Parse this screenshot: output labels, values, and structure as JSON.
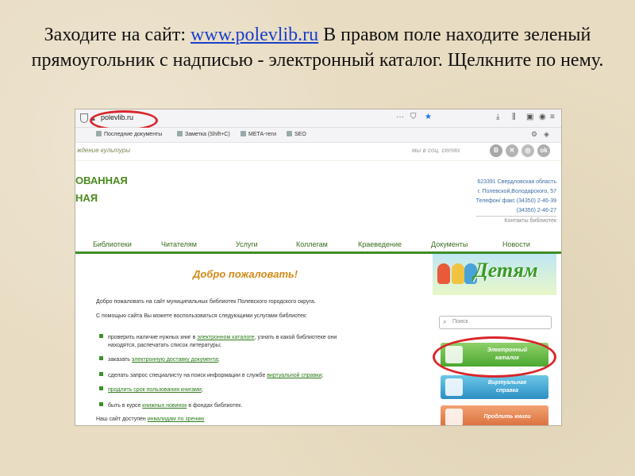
{
  "slide": {
    "title_before": "Заходите на сайт: ",
    "title_link": "www.polevlib.ru",
    "title_after": " В правом поле находите зеленый прямоугольник с надписью - электронный каталог. Щелкните по нему."
  },
  "browser": {
    "url": "polevlib.ru",
    "bookmarks": [
      "Последние документы",
      "Заметка (Shift+C)",
      "МЕТА-теги",
      "SEO"
    ]
  },
  "site": {
    "subtitle": "ждение культуры",
    "social_label": "мы в соц. сетях",
    "social_icons": [
      "В",
      "✕",
      "◎",
      "ok"
    ],
    "name_line1": "ОВАННАЯ",
    "name_line2": "НАЯ",
    "contacts": {
      "line1": "623391 Свердловская область",
      "line2": "г. Полевской,Володарского, 57",
      "line3": "Телефон/ факс (34350) 2-46-39",
      "line4": "(34350) 2-46-27",
      "link": "Контакты библиотек"
    },
    "nav": [
      "Библиотеки",
      "Читателям",
      "Услуги",
      "Коллегам",
      "Краеведение",
      "Документы",
      "Новости"
    ]
  },
  "main": {
    "welcome": "Добро пожаловать!",
    "intro": "Добро пожаловать на сайт муниципальных библиотек Полевского городского округа.",
    "services_intro": "С помощью сайта Вы можете воспользоваться следующими услугами библиотек:",
    "items": [
      {
        "pre": "проверить наличие нужных книг в ",
        "link": "электронном каталоге",
        "post": ", узнать в какой библиотеке они"
      },
      {
        "pre": "находятся, распечатать список литературы;",
        "link": "",
        "post": ""
      },
      {
        "pre": "заказать ",
        "link": "электронную доставку документа",
        "post": ";"
      },
      {
        "pre": "сделать запрос специалисту на поиск информации в службе ",
        "link": "виртуальной справки",
        "post": ";"
      },
      {
        "pre": "",
        "link": "продлить срок пользования книгами",
        "post": ";"
      },
      {
        "pre": "быть в курсе ",
        "link": "книжных новинок",
        "post": " в фондах библиотек."
      }
    ],
    "footer_pre": "Наш сайт доступен ",
    "footer_link": "инвалидам по зрению"
  },
  "sidebar": {
    "kids": "Детям",
    "search_placeholder": "Поиск",
    "catalog_line1": "Электронный",
    "catalog_line2": "каталог",
    "virtual_line1": "Виртуальная",
    "virtual_line2": "справка",
    "renew": "Продлить книги"
  },
  "colors": {
    "highlight": "#d8262a",
    "site_green": "#3f8d28",
    "link_blue": "#1a3fc9"
  }
}
